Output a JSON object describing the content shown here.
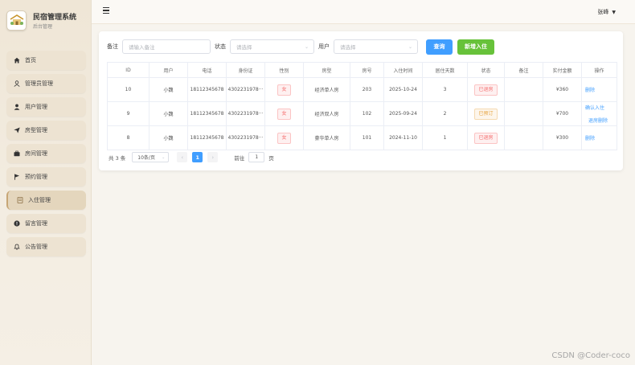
{
  "app": {
    "title": "民宿管理系统",
    "subtitle": "后台管理"
  },
  "sidebar": {
    "items": [
      {
        "label": "首页",
        "icon": "home-icon"
      },
      {
        "label": "管理员管理",
        "icon": "user-outline-icon"
      },
      {
        "label": "用户管理",
        "icon": "user-icon"
      },
      {
        "label": "房型管理",
        "icon": "send-icon"
      },
      {
        "label": "房间管理",
        "icon": "briefcase-icon"
      },
      {
        "label": "预约管理",
        "icon": "flag-icon"
      },
      {
        "label": "入住管理",
        "icon": "document-icon",
        "active": true
      },
      {
        "label": "留言管理",
        "icon": "warning-icon"
      },
      {
        "label": "公告管理",
        "icon": "bell-icon"
      }
    ]
  },
  "header": {
    "user_name": "张峰"
  },
  "filter": {
    "remark_label": "备注",
    "remark_placeholder": "请输入备注",
    "status_label": "状态",
    "status_placeholder": "请选择",
    "user_label": "用户",
    "user_placeholder": "请选择",
    "query_label": "查询",
    "add_label": "新增入住"
  },
  "table": {
    "headers": [
      "ID",
      "用户",
      "电话",
      "身份证",
      "性别",
      "房型",
      "房号",
      "入住时间",
      "居住天数",
      "状态",
      "备注",
      "实付金额",
      "操作"
    ],
    "rows": [
      {
        "id": "10",
        "user": "小魏",
        "phone": "18112345678",
        "idcard": "4302231978···",
        "gender": "女",
        "room_type": "经济单人房",
        "room_no": "203",
        "checkin": "2025-10-24",
        "days": "3",
        "status": "已退房",
        "status_color": "red",
        "remark": "",
        "amount": "¥360",
        "ops": [
          "删除"
        ]
      },
      {
        "id": "9",
        "user": "小魏",
        "phone": "18112345678",
        "idcard": "4302231978···",
        "gender": "女",
        "room_type": "经济双人房",
        "room_no": "102",
        "checkin": "2025-09-24",
        "days": "2",
        "status": "已预订",
        "status_color": "orange",
        "remark": "",
        "amount": "¥700",
        "ops": [
          "确认入住",
          "退房删除"
        ]
      },
      {
        "id": "8",
        "user": "小魏",
        "phone": "18112345678",
        "idcard": "4302231978···",
        "gender": "女",
        "room_type": "豪华单人房",
        "room_no": "101",
        "checkin": "2024-11-10",
        "days": "1",
        "status": "已退房",
        "status_color": "red",
        "remark": "",
        "amount": "¥300",
        "ops": [
          "删除"
        ]
      }
    ]
  },
  "pager": {
    "total": "共 3 条",
    "size": "10条/页",
    "current": "1",
    "goto_label": "前往",
    "goto_value": "1",
    "page_suffix": "页",
    "prev": "‹",
    "next": "›"
  },
  "watermark": "CSDN @Coder-coco"
}
